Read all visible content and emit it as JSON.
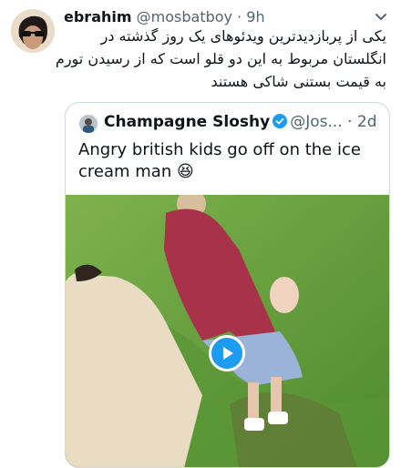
{
  "tweet": {
    "author_name": "ebrahim",
    "handle": "@mosbatboy",
    "separator": "·",
    "time": "9h",
    "text_lines": [
      "یکی از پربازدیدترین ویدئوهای یک روز گذشته در",
      "انگلستان مربوط به این دو قلو است که از رسیدن تورم",
      "به قیمت بستنی شاکی هستند"
    ]
  },
  "quoted": {
    "author_name": "Champagne Sloshy",
    "handle": "@Jos...",
    "separator": "·",
    "time": "2d",
    "text": "Angry british kids go off on the ice cream man 😆"
  },
  "icons": [
    "avatar",
    "chevron-down-icon",
    "verified-badge-icon",
    "play-icon"
  ],
  "colors": {
    "accent": "#1d9bf0",
    "text": "#0f1419",
    "muted": "#536471",
    "border": "#cfd9de",
    "grass": "#5f9a3c"
  }
}
